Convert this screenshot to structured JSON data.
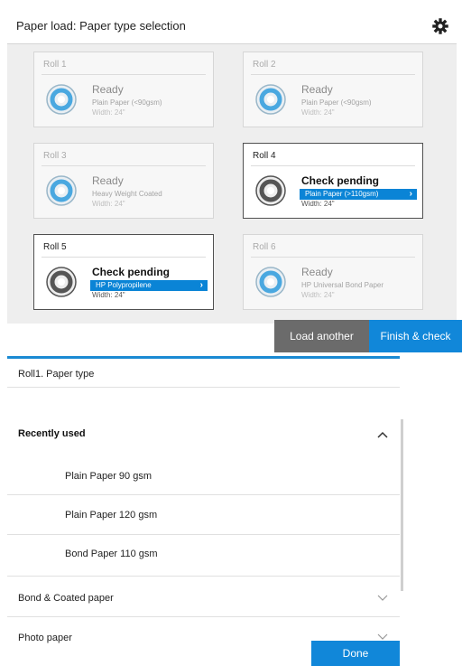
{
  "top": {
    "title": "Paper load: Paper type selection",
    "rolls": [
      {
        "title": "Roll 1",
        "status": "Ready",
        "paper": "Plain Paper (<90gsm)",
        "width": "Width: 24\""
      },
      {
        "title": "Roll 2",
        "status": "Ready",
        "paper": "Plain Paper (<90gsm)",
        "width": "Width: 24\""
      },
      {
        "title": "Roll 3",
        "status": "Ready",
        "paper": "Heavy Weight Coated",
        "width": "Width: 24\""
      },
      {
        "title": "Roll 4",
        "status": "Check pending",
        "paper": "Plain Paper (>110gsm)",
        "width": "Width: 24\""
      },
      {
        "title": "Roll 5",
        "status": "Check pending",
        "paper": "HP Polypropilene",
        "width": "Width: 24\""
      },
      {
        "title": "Roll 6",
        "status": "Ready",
        "paper": "HP Universal Bond Paper",
        "width": "Width: 24\""
      }
    ],
    "buttons": {
      "load_another": "Load another",
      "finish_check": "Finish & check"
    }
  },
  "bottom": {
    "title": "Roll1. Paper type",
    "recent": {
      "label": "Recently used",
      "items": [
        "Plain Paper 90 gsm",
        "Plain Paper 120 gsm",
        "Bond Paper 110 gsm"
      ]
    },
    "groups": [
      "Bond & Coated paper",
      "Photo paper"
    ],
    "done": "Done"
  },
  "colors": {
    "accent": "#1187d9",
    "gray_button": "#6b6b6b"
  },
  "icons": [
    "gear-icon",
    "roll-icon",
    "chevron-right-icon",
    "chevron-up-icon",
    "chevron-down-icon"
  ]
}
